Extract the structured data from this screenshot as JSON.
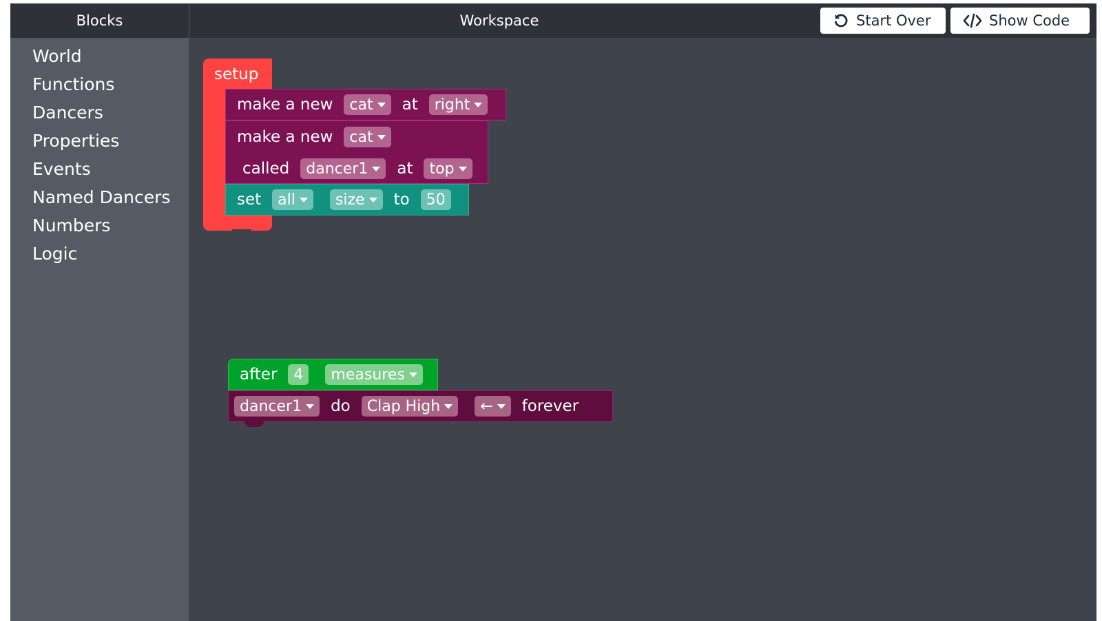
{
  "header": {
    "blocks_title": "Blocks",
    "workspace_title": "Workspace",
    "start_over_label": "Start Over",
    "show_code_label": "Show Code"
  },
  "categories": [
    "World",
    "Functions",
    "Dancers",
    "Properties",
    "Events",
    "Named Dancers",
    "Numbers",
    "Logic"
  ],
  "blocks": {
    "setup": {
      "label": "setup",
      "color": "#ff4343",
      "stmt1": {
        "text1": "make a new",
        "dancer": "cat",
        "text2": "at",
        "location": "right"
      },
      "stmt2": {
        "text1": "make a new",
        "dancer": "cat",
        "text2": "called",
        "name": "dancer1",
        "text3": "at",
        "location": "top"
      },
      "stmt3": {
        "text1": "set",
        "target": "all",
        "property": "size",
        "text2": "to",
        "value": "50"
      }
    },
    "after": {
      "text1": "after",
      "count": "4",
      "unit": "measures",
      "stmt": {
        "dancer": "dancer1",
        "text1": "do",
        "move": "Clap High",
        "direction": "←",
        "text2": "forever"
      }
    }
  },
  "colors": {
    "header_bg": "#2e3238",
    "flyout_bg": "#555b63",
    "workspace_bg": "#3f444c",
    "setup_red": "#ff4343",
    "dancer_magenta": "#7d1253",
    "set_teal": "#11917f",
    "event_green": "#00a32a",
    "do_dark_magenta": "#5f0d3e"
  }
}
